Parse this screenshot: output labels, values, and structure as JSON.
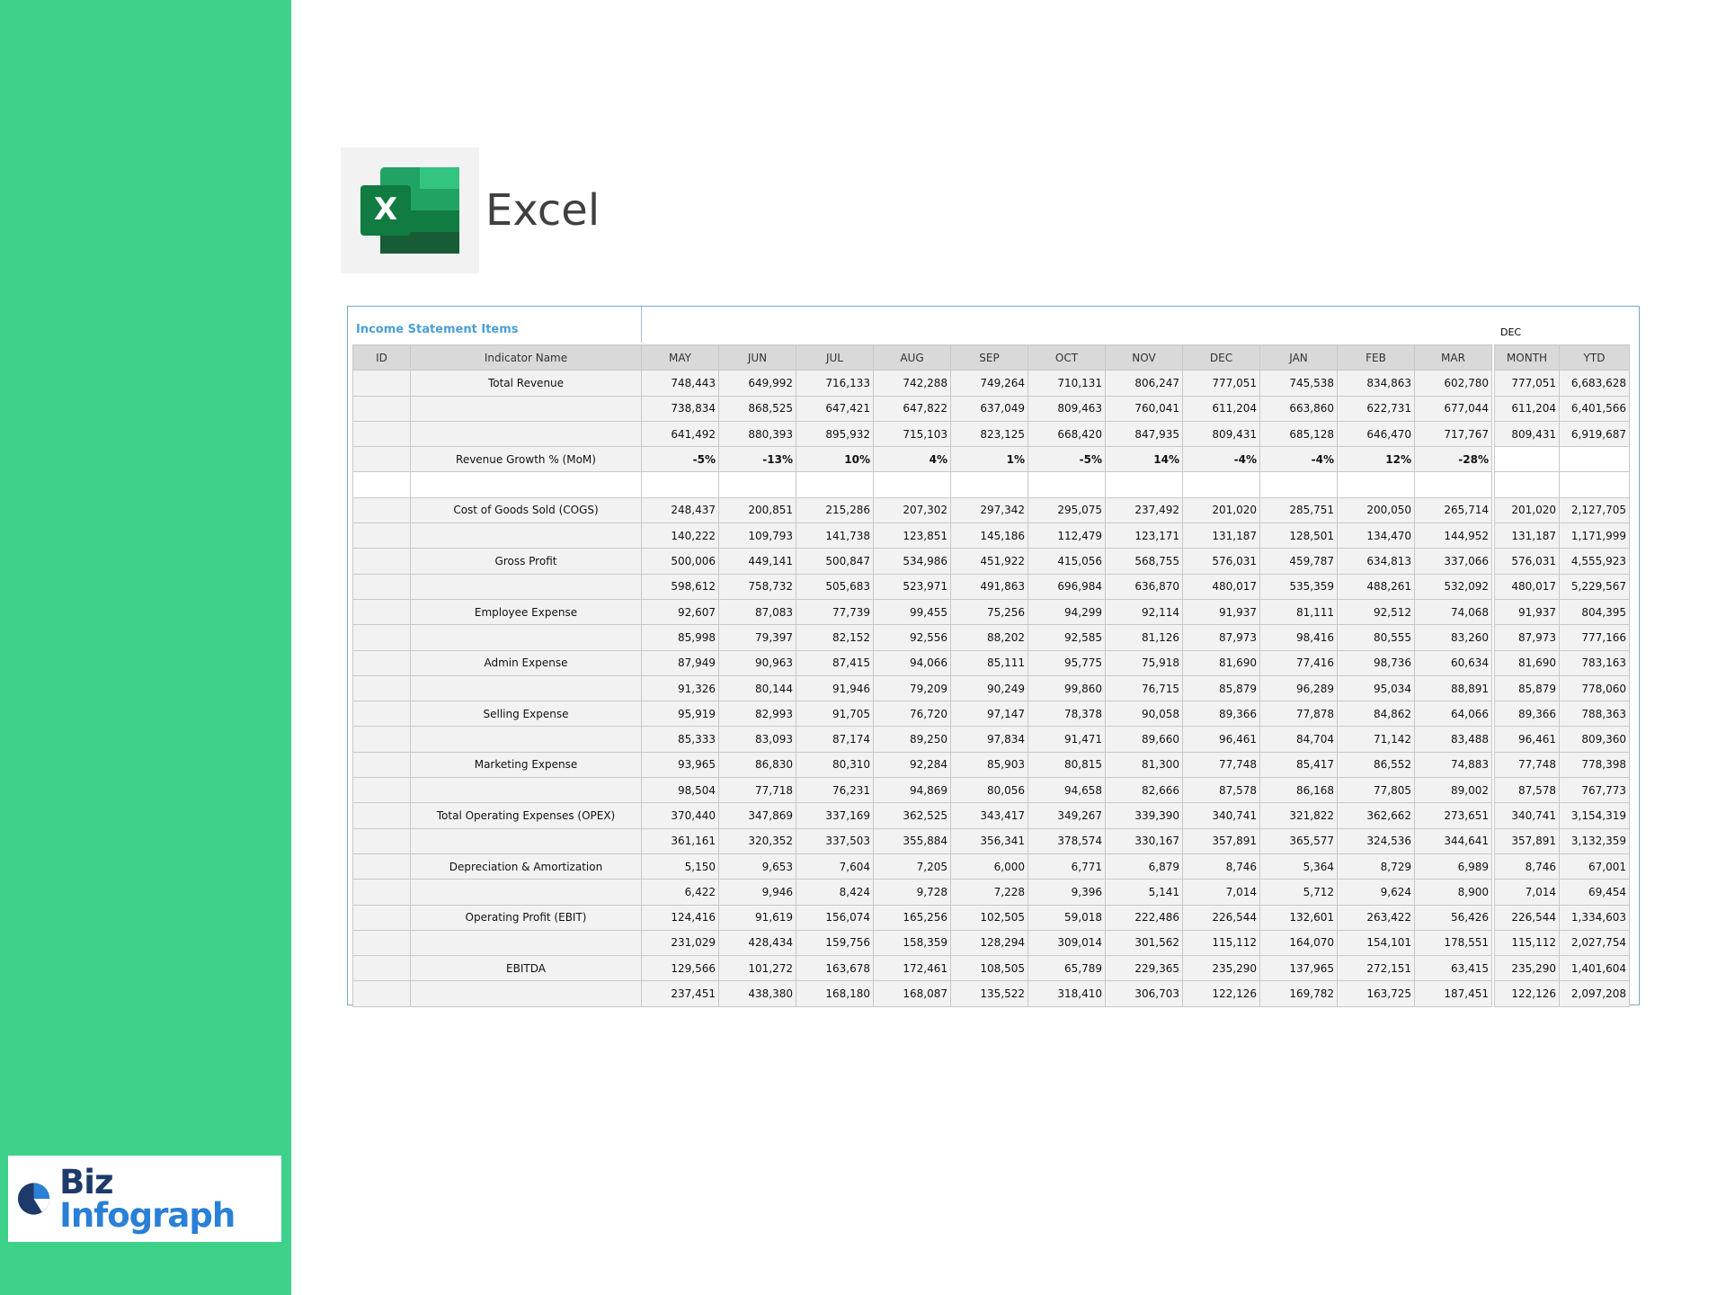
{
  "app": {
    "title": "Excel"
  },
  "brand": {
    "word1": "Biz",
    "word2": "Infograph"
  },
  "colors": {
    "sidebar": "#3dd18a",
    "excel_green": "#1e7145",
    "title_blue": "#4a9fd6"
  },
  "sheet": {
    "title": "Income Statement Items",
    "period_label": "DEC",
    "headers": {
      "id": "ID",
      "name": "Indicator Name",
      "months": [
        "MAY",
        "JUN",
        "JUL",
        "AUG",
        "SEP",
        "OCT",
        "NOV",
        "DEC",
        "JAN",
        "FEB",
        "MAR"
      ],
      "summary": [
        "MONTH",
        "YTD"
      ]
    },
    "rows": [
      {
        "name": "Total Revenue",
        "values": [
          "748,443",
          "649,992",
          "716,133",
          "742,288",
          "749,264",
          "710,131",
          "806,247",
          "777,051",
          "745,538",
          "834,863",
          "602,780"
        ],
        "summary": [
          "777,051",
          "6,683,628"
        ]
      },
      {
        "name": "",
        "values": [
          "738,834",
          "868,525",
          "647,421",
          "647,822",
          "637,049",
          "809,463",
          "760,041",
          "611,204",
          "663,860",
          "622,731",
          "677,044"
        ],
        "summary": [
          "611,204",
          "6,401,566"
        ]
      },
      {
        "name": "",
        "values": [
          "641,492",
          "880,393",
          "895,932",
          "715,103",
          "823,125",
          "668,420",
          "847,935",
          "809,431",
          "685,128",
          "646,470",
          "717,767"
        ],
        "summary": [
          "809,431",
          "6,919,687"
        ]
      },
      {
        "name": "Revenue Growth % (MoM)",
        "bold": true,
        "values": [
          "-5%",
          "-13%",
          "10%",
          "4%",
          "1%",
          "-5%",
          "14%",
          "-4%",
          "-4%",
          "12%",
          "-28%"
        ],
        "summary": [
          "",
          ""
        ]
      },
      {
        "name": "",
        "blank": true,
        "values": [
          "",
          "",
          "",
          "",
          "",
          "",
          "",
          "",
          "",
          "",
          ""
        ],
        "summary": [
          "",
          ""
        ]
      },
      {
        "name": "Cost of Goods Sold (COGS)",
        "values": [
          "248,437",
          "200,851",
          "215,286",
          "207,302",
          "297,342",
          "295,075",
          "237,492",
          "201,020",
          "285,751",
          "200,050",
          "265,714"
        ],
        "summary": [
          "201,020",
          "2,127,705"
        ]
      },
      {
        "name": "",
        "values": [
          "140,222",
          "109,793",
          "141,738",
          "123,851",
          "145,186",
          "112,479",
          "123,171",
          "131,187",
          "128,501",
          "134,470",
          "144,952"
        ],
        "summary": [
          "131,187",
          "1,171,999"
        ]
      },
      {
        "name": "Gross Profit",
        "values": [
          "500,006",
          "449,141",
          "500,847",
          "534,986",
          "451,922",
          "415,056",
          "568,755",
          "576,031",
          "459,787",
          "634,813",
          "337,066"
        ],
        "summary": [
          "576,031",
          "4,555,923"
        ]
      },
      {
        "name": "",
        "values": [
          "598,612",
          "758,732",
          "505,683",
          "523,971",
          "491,863",
          "696,984",
          "636,870",
          "480,017",
          "535,359",
          "488,261",
          "532,092"
        ],
        "summary": [
          "480,017",
          "5,229,567"
        ]
      },
      {
        "name": "Employee Expense",
        "values": [
          "92,607",
          "87,083",
          "77,739",
          "99,455",
          "75,256",
          "94,299",
          "92,114",
          "91,937",
          "81,111",
          "92,512",
          "74,068"
        ],
        "summary": [
          "91,937",
          "804,395"
        ]
      },
      {
        "name": "",
        "values": [
          "85,998",
          "79,397",
          "82,152",
          "92,556",
          "88,202",
          "92,585",
          "81,126",
          "87,973",
          "98,416",
          "80,555",
          "83,260"
        ],
        "summary": [
          "87,973",
          "777,166"
        ]
      },
      {
        "name": "Admin Expense",
        "values": [
          "87,949",
          "90,963",
          "87,415",
          "94,066",
          "85,111",
          "95,775",
          "75,918",
          "81,690",
          "77,416",
          "98,736",
          "60,634"
        ],
        "summary": [
          "81,690",
          "783,163"
        ]
      },
      {
        "name": "",
        "values": [
          "91,326",
          "80,144",
          "91,946",
          "79,209",
          "90,249",
          "99,860",
          "76,715",
          "85,879",
          "96,289",
          "95,034",
          "88,891"
        ],
        "summary": [
          "85,879",
          "778,060"
        ]
      },
      {
        "name": "Selling Expense",
        "values": [
          "95,919",
          "82,993",
          "91,705",
          "76,720",
          "97,147",
          "78,378",
          "90,058",
          "89,366",
          "77,878",
          "84,862",
          "64,066"
        ],
        "summary": [
          "89,366",
          "788,363"
        ]
      },
      {
        "name": "",
        "values": [
          "85,333",
          "83,093",
          "87,174",
          "89,250",
          "97,834",
          "91,471",
          "89,660",
          "96,461",
          "84,704",
          "71,142",
          "83,488"
        ],
        "summary": [
          "96,461",
          "809,360"
        ]
      },
      {
        "name": "Marketing Expense",
        "values": [
          "93,965",
          "86,830",
          "80,310",
          "92,284",
          "85,903",
          "80,815",
          "81,300",
          "77,748",
          "85,417",
          "86,552",
          "74,883"
        ],
        "summary": [
          "77,748",
          "778,398"
        ]
      },
      {
        "name": "",
        "values": [
          "98,504",
          "77,718",
          "76,231",
          "94,869",
          "80,056",
          "94,658",
          "82,666",
          "87,578",
          "86,168",
          "77,805",
          "89,002"
        ],
        "summary": [
          "87,578",
          "767,773"
        ]
      },
      {
        "name": "Total Operating Expenses (OPEX)",
        "values": [
          "370,440",
          "347,869",
          "337,169",
          "362,525",
          "343,417",
          "349,267",
          "339,390",
          "340,741",
          "321,822",
          "362,662",
          "273,651"
        ],
        "summary": [
          "340,741",
          "3,154,319"
        ]
      },
      {
        "name": "",
        "values": [
          "361,161",
          "320,352",
          "337,503",
          "355,884",
          "356,341",
          "378,574",
          "330,167",
          "357,891",
          "365,577",
          "324,536",
          "344,641"
        ],
        "summary": [
          "357,891",
          "3,132,359"
        ]
      },
      {
        "name": "Depreciation & Amortization",
        "values": [
          "5,150",
          "9,653",
          "7,604",
          "7,205",
          "6,000",
          "6,771",
          "6,879",
          "8,746",
          "5,364",
          "8,729",
          "6,989"
        ],
        "summary": [
          "8,746",
          "67,001"
        ]
      },
      {
        "name": "",
        "values": [
          "6,422",
          "9,946",
          "8,424",
          "9,728",
          "7,228",
          "9,396",
          "5,141",
          "7,014",
          "5,712",
          "9,624",
          "8,900"
        ],
        "summary": [
          "7,014",
          "69,454"
        ]
      },
      {
        "name": "Operating Profit (EBIT)",
        "values": [
          "124,416",
          "91,619",
          "156,074",
          "165,256",
          "102,505",
          "59,018",
          "222,486",
          "226,544",
          "132,601",
          "263,422",
          "56,426"
        ],
        "summary": [
          "226,544",
          "1,334,603"
        ]
      },
      {
        "name": "",
        "values": [
          "231,029",
          "428,434",
          "159,756",
          "158,359",
          "128,294",
          "309,014",
          "301,562",
          "115,112",
          "164,070",
          "154,101",
          "178,551"
        ],
        "summary": [
          "115,112",
          "2,027,754"
        ]
      },
      {
        "name": "EBITDA",
        "values": [
          "129,566",
          "101,272",
          "163,678",
          "172,461",
          "108,505",
          "65,789",
          "229,365",
          "235,290",
          "137,965",
          "272,151",
          "63,415"
        ],
        "summary": [
          "235,290",
          "1,401,604"
        ]
      },
      {
        "name": "",
        "values": [
          "237,451",
          "438,380",
          "168,180",
          "168,087",
          "135,522",
          "318,410",
          "306,703",
          "122,126",
          "169,782",
          "163,725",
          "187,451"
        ],
        "summary": [
          "122,126",
          "2,097,208"
        ]
      }
    ]
  }
}
